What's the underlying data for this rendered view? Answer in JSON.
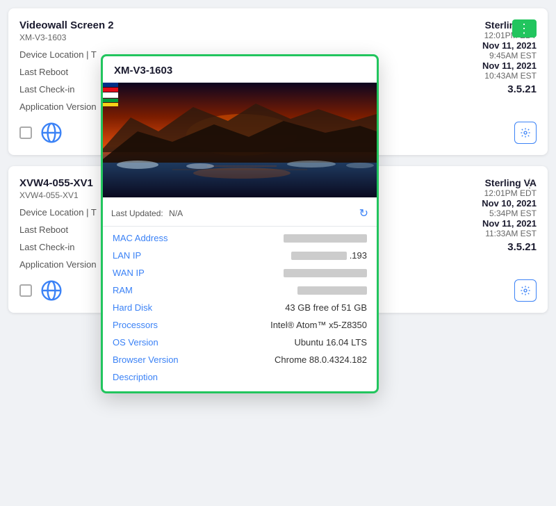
{
  "cards": [
    {
      "id": "card-1",
      "device_name": "Videowall Screen 2",
      "device_id": "XM-V3-1603",
      "location_label": "Device Location | T",
      "last_reboot_label": "Last Reboot",
      "last_checkin_label": "Last Check-in",
      "app_version_label": "Application Version",
      "location": "Sterling VA",
      "reboot_time": "12:01PM EDT",
      "reboot_date": "Nov 11, 2021",
      "checkin_time": "9:45AM EST",
      "checkin_date": "Nov 11, 2021",
      "checkin_time2": "10:43AM EST",
      "version": "3.5.21",
      "dots_highlighted": true
    },
    {
      "id": "card-2",
      "device_name": "XVW4-055-XV1",
      "device_id": "XVW4-055-XV1",
      "location_label": "Device Location | T",
      "last_reboot_label": "Last Reboot",
      "last_checkin_label": "Last Check-in",
      "app_version_label": "Application Version",
      "location": "Sterling VA",
      "reboot_time": "12:01PM EDT",
      "reboot_date": "Nov 10, 2021",
      "checkin_time": "5:34PM EST",
      "checkin_date": "Nov 11, 2021",
      "checkin_time2": "11:33AM EST",
      "version": "3.5.21",
      "dots_highlighted": false
    }
  ],
  "popup": {
    "title": "XM-V3-1603",
    "last_updated_label": "Last Updated:",
    "last_updated_value": "N/A",
    "fields": [
      {
        "label": "MAC Address",
        "value": "",
        "blurred": "long"
      },
      {
        "label": "LAN IP",
        "value": ".193",
        "blurred": "partial",
        "prefix_blurred": true
      },
      {
        "label": "WAN IP",
        "value": "",
        "blurred": "long"
      },
      {
        "label": "RAM",
        "value": "",
        "blurred": "medium"
      },
      {
        "label": "Hard Disk",
        "value": "43 GB free of 51 GB",
        "blurred": "none"
      },
      {
        "label": "Processors",
        "value": "Intel® Atom™ x5-Z8350",
        "blurred": "none"
      },
      {
        "label": "OS Version",
        "value": "Ubuntu 16.04 LTS",
        "blurred": "none"
      },
      {
        "label": "Browser Version",
        "value": "Chrome 88.0.4324.182",
        "blurred": "none"
      },
      {
        "label": "Description",
        "value": "",
        "blurred": "none"
      }
    ]
  },
  "icons": {
    "three_dots": "⋮",
    "refresh": "↻",
    "gear": "⚙"
  }
}
